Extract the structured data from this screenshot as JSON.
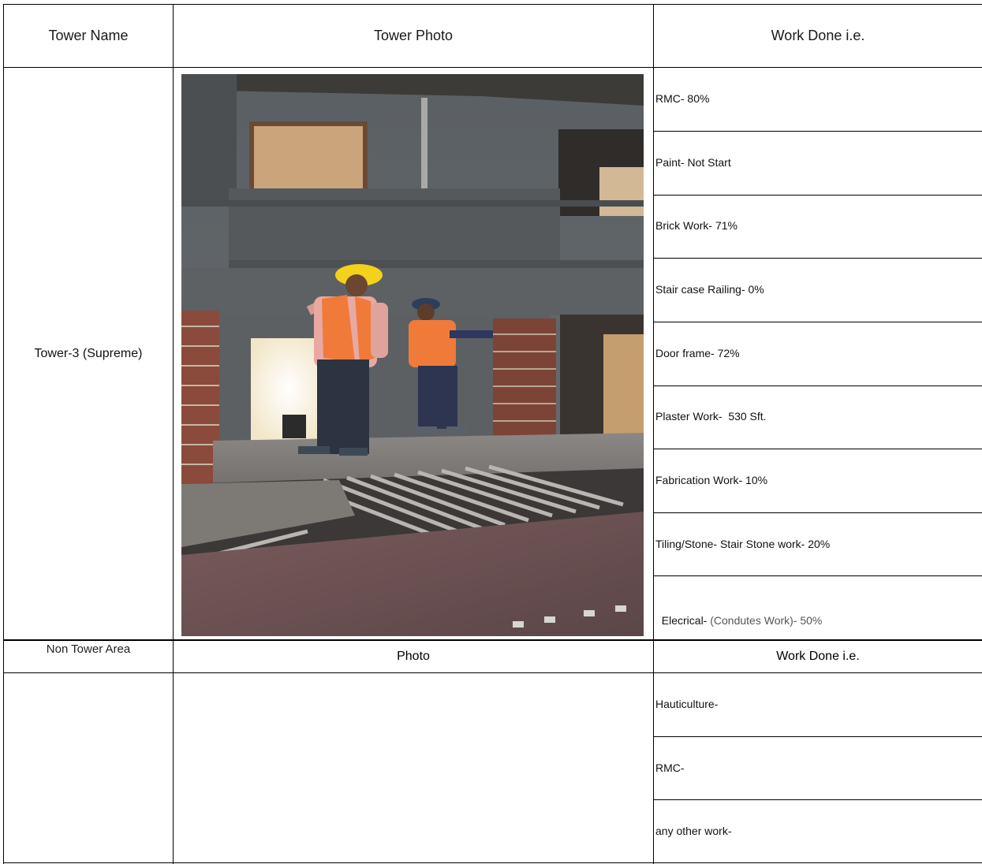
{
  "tower_table": {
    "headers": {
      "tower_name": "Tower Name",
      "tower_photo": "Tower Photo",
      "work_done": "Work Done i.e."
    },
    "tower": "Tower-3 (Supreme)",
    "work_items": [
      "RMC- 80%",
      "Paint- Not Start",
      "Brick Work- 71%",
      "Stair case Railing- 0%",
      "Door frame- 72%",
      "Plaster Work-  530 Sft.",
      "Fabrication Work- 10%",
      "Tiling/Stone- Stair Stone work- 20%"
    ],
    "electrical": {
      "prefix": "Elecrical- ",
      "detail": "(Condutes Work)- 50%"
    }
  },
  "non_tower_table": {
    "headers": {
      "area": "Non Tower Area",
      "photo": "Photo",
      "work_done": "Work Done i.e."
    },
    "work_items": [
      "Hauticulture-",
      "RMC-",
      "any other work-"
    ]
  }
}
